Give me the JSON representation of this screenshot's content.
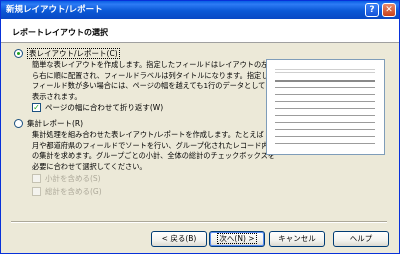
{
  "window": {
    "title": "新規レイアウト/レポート",
    "help_glyph": "?",
    "close_glyph": "✕"
  },
  "heading": "レポートレイアウトの選択",
  "options": [
    {
      "label": "表レイアウト/レポート(C)",
      "selected": true,
      "description": [
        "簡単な表レイアウトを作成します。指定したフィールドはレイアウトの左か",
        "ら右に順に配置され、フィールドラベルは列タイトルになります。指定した",
        "フィールド数が多い場合には、ページの幅を越えても1行のデータとして",
        "表示されます。"
      ],
      "checkbox": {
        "label": "ページの幅に合わせて折り返す(W)",
        "checked": true,
        "check_glyph": "✓"
      }
    },
    {
      "label": "集計レポート(R)",
      "selected": false,
      "description": [
        "集計処理を組み合わせた表レイアウト/レポートを作成します。たとえば",
        "月や都道府県のフィールドでソートを行い、グループ化されたレコード内",
        "の集計を求めます。グループごとの小計、全体の総計のチェックボックスを",
        "必要に合わせて選択してください。"
      ],
      "checkboxes": [
        {
          "label": "小計を含める(S)",
          "checked": false,
          "enabled": false
        },
        {
          "label": "総計を含める(G)",
          "checked": false,
          "enabled": false
        }
      ]
    }
  ],
  "buttons": {
    "back": "< 戻る(B)",
    "next": "次へ(N) >",
    "cancel": "キャンセル",
    "help": "ヘルプ"
  }
}
